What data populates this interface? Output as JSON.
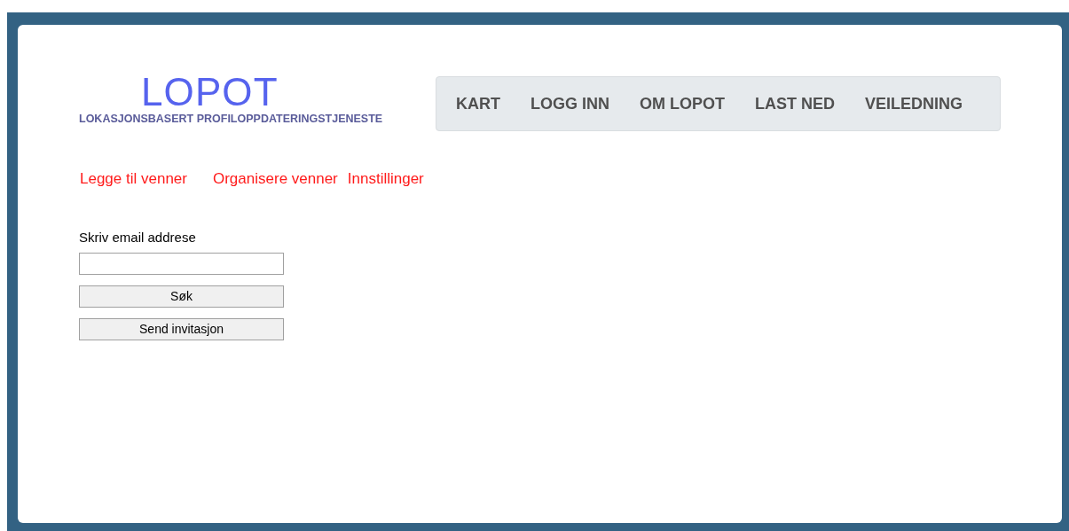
{
  "logo": {
    "title": "LOPOT",
    "subtitle": "LOKASJONSBASERT PROFILOPPDATERINGSTJENESTE"
  },
  "nav": [
    {
      "label": "KART"
    },
    {
      "label": "LOGG INN"
    },
    {
      "label": "OM LOPOT"
    },
    {
      "label": "LAST NED"
    },
    {
      "label": "VEILEDNING"
    }
  ],
  "sub_links": [
    {
      "label": "Legge til venner"
    },
    {
      "label": "Organisere venner"
    },
    {
      "label": "Innstillinger"
    }
  ],
  "form": {
    "label": "Skriv email addrese",
    "buttons": [
      "Søk",
      "Send invitasjon"
    ]
  }
}
